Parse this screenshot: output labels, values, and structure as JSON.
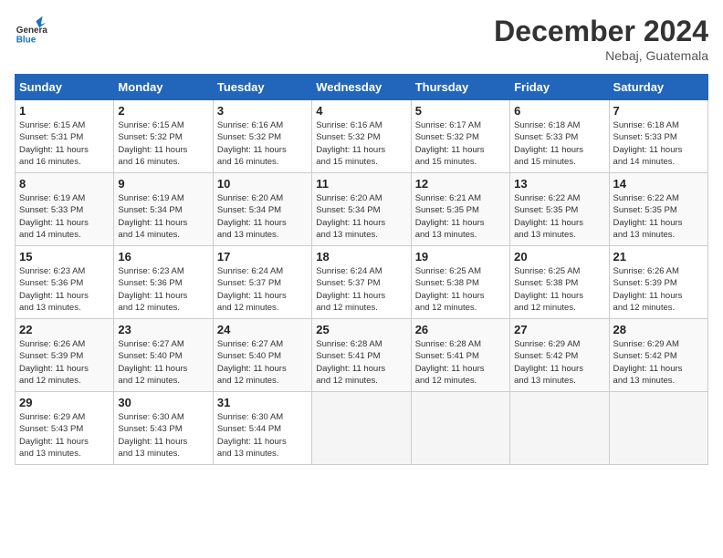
{
  "header": {
    "logo_line1": "General",
    "logo_line2": "Blue",
    "month": "December 2024",
    "location": "Nebaj, Guatemala"
  },
  "days_of_week": [
    "Sunday",
    "Monday",
    "Tuesday",
    "Wednesday",
    "Thursday",
    "Friday",
    "Saturday"
  ],
  "weeks": [
    [
      {
        "day": 1,
        "info": "Sunrise: 6:15 AM\nSunset: 5:31 PM\nDaylight: 11 hours\nand 16 minutes."
      },
      {
        "day": 2,
        "info": "Sunrise: 6:15 AM\nSunset: 5:32 PM\nDaylight: 11 hours\nand 16 minutes."
      },
      {
        "day": 3,
        "info": "Sunrise: 6:16 AM\nSunset: 5:32 PM\nDaylight: 11 hours\nand 16 minutes."
      },
      {
        "day": 4,
        "info": "Sunrise: 6:16 AM\nSunset: 5:32 PM\nDaylight: 11 hours\nand 15 minutes."
      },
      {
        "day": 5,
        "info": "Sunrise: 6:17 AM\nSunset: 5:32 PM\nDaylight: 11 hours\nand 15 minutes."
      },
      {
        "day": 6,
        "info": "Sunrise: 6:18 AM\nSunset: 5:33 PM\nDaylight: 11 hours\nand 15 minutes."
      },
      {
        "day": 7,
        "info": "Sunrise: 6:18 AM\nSunset: 5:33 PM\nDaylight: 11 hours\nand 14 minutes."
      }
    ],
    [
      {
        "day": 8,
        "info": "Sunrise: 6:19 AM\nSunset: 5:33 PM\nDaylight: 11 hours\nand 14 minutes."
      },
      {
        "day": 9,
        "info": "Sunrise: 6:19 AM\nSunset: 5:34 PM\nDaylight: 11 hours\nand 14 minutes."
      },
      {
        "day": 10,
        "info": "Sunrise: 6:20 AM\nSunset: 5:34 PM\nDaylight: 11 hours\nand 13 minutes."
      },
      {
        "day": 11,
        "info": "Sunrise: 6:20 AM\nSunset: 5:34 PM\nDaylight: 11 hours\nand 13 minutes."
      },
      {
        "day": 12,
        "info": "Sunrise: 6:21 AM\nSunset: 5:35 PM\nDaylight: 11 hours\nand 13 minutes."
      },
      {
        "day": 13,
        "info": "Sunrise: 6:22 AM\nSunset: 5:35 PM\nDaylight: 11 hours\nand 13 minutes."
      },
      {
        "day": 14,
        "info": "Sunrise: 6:22 AM\nSunset: 5:35 PM\nDaylight: 11 hours\nand 13 minutes."
      }
    ],
    [
      {
        "day": 15,
        "info": "Sunrise: 6:23 AM\nSunset: 5:36 PM\nDaylight: 11 hours\nand 13 minutes."
      },
      {
        "day": 16,
        "info": "Sunrise: 6:23 AM\nSunset: 5:36 PM\nDaylight: 11 hours\nand 12 minutes."
      },
      {
        "day": 17,
        "info": "Sunrise: 6:24 AM\nSunset: 5:37 PM\nDaylight: 11 hours\nand 12 minutes."
      },
      {
        "day": 18,
        "info": "Sunrise: 6:24 AM\nSunset: 5:37 PM\nDaylight: 11 hours\nand 12 minutes."
      },
      {
        "day": 19,
        "info": "Sunrise: 6:25 AM\nSunset: 5:38 PM\nDaylight: 11 hours\nand 12 minutes."
      },
      {
        "day": 20,
        "info": "Sunrise: 6:25 AM\nSunset: 5:38 PM\nDaylight: 11 hours\nand 12 minutes."
      },
      {
        "day": 21,
        "info": "Sunrise: 6:26 AM\nSunset: 5:39 PM\nDaylight: 11 hours\nand 12 minutes."
      }
    ],
    [
      {
        "day": 22,
        "info": "Sunrise: 6:26 AM\nSunset: 5:39 PM\nDaylight: 11 hours\nand 12 minutes."
      },
      {
        "day": 23,
        "info": "Sunrise: 6:27 AM\nSunset: 5:40 PM\nDaylight: 11 hours\nand 12 minutes."
      },
      {
        "day": 24,
        "info": "Sunrise: 6:27 AM\nSunset: 5:40 PM\nDaylight: 11 hours\nand 12 minutes."
      },
      {
        "day": 25,
        "info": "Sunrise: 6:28 AM\nSunset: 5:41 PM\nDaylight: 11 hours\nand 12 minutes."
      },
      {
        "day": 26,
        "info": "Sunrise: 6:28 AM\nSunset: 5:41 PM\nDaylight: 11 hours\nand 12 minutes."
      },
      {
        "day": 27,
        "info": "Sunrise: 6:29 AM\nSunset: 5:42 PM\nDaylight: 11 hours\nand 13 minutes."
      },
      {
        "day": 28,
        "info": "Sunrise: 6:29 AM\nSunset: 5:42 PM\nDaylight: 11 hours\nand 13 minutes."
      }
    ],
    [
      {
        "day": 29,
        "info": "Sunrise: 6:29 AM\nSunset: 5:43 PM\nDaylight: 11 hours\nand 13 minutes."
      },
      {
        "day": 30,
        "info": "Sunrise: 6:30 AM\nSunset: 5:43 PM\nDaylight: 11 hours\nand 13 minutes."
      },
      {
        "day": 31,
        "info": "Sunrise: 6:30 AM\nSunset: 5:44 PM\nDaylight: 11 hours\nand 13 minutes."
      },
      null,
      null,
      null,
      null
    ]
  ]
}
